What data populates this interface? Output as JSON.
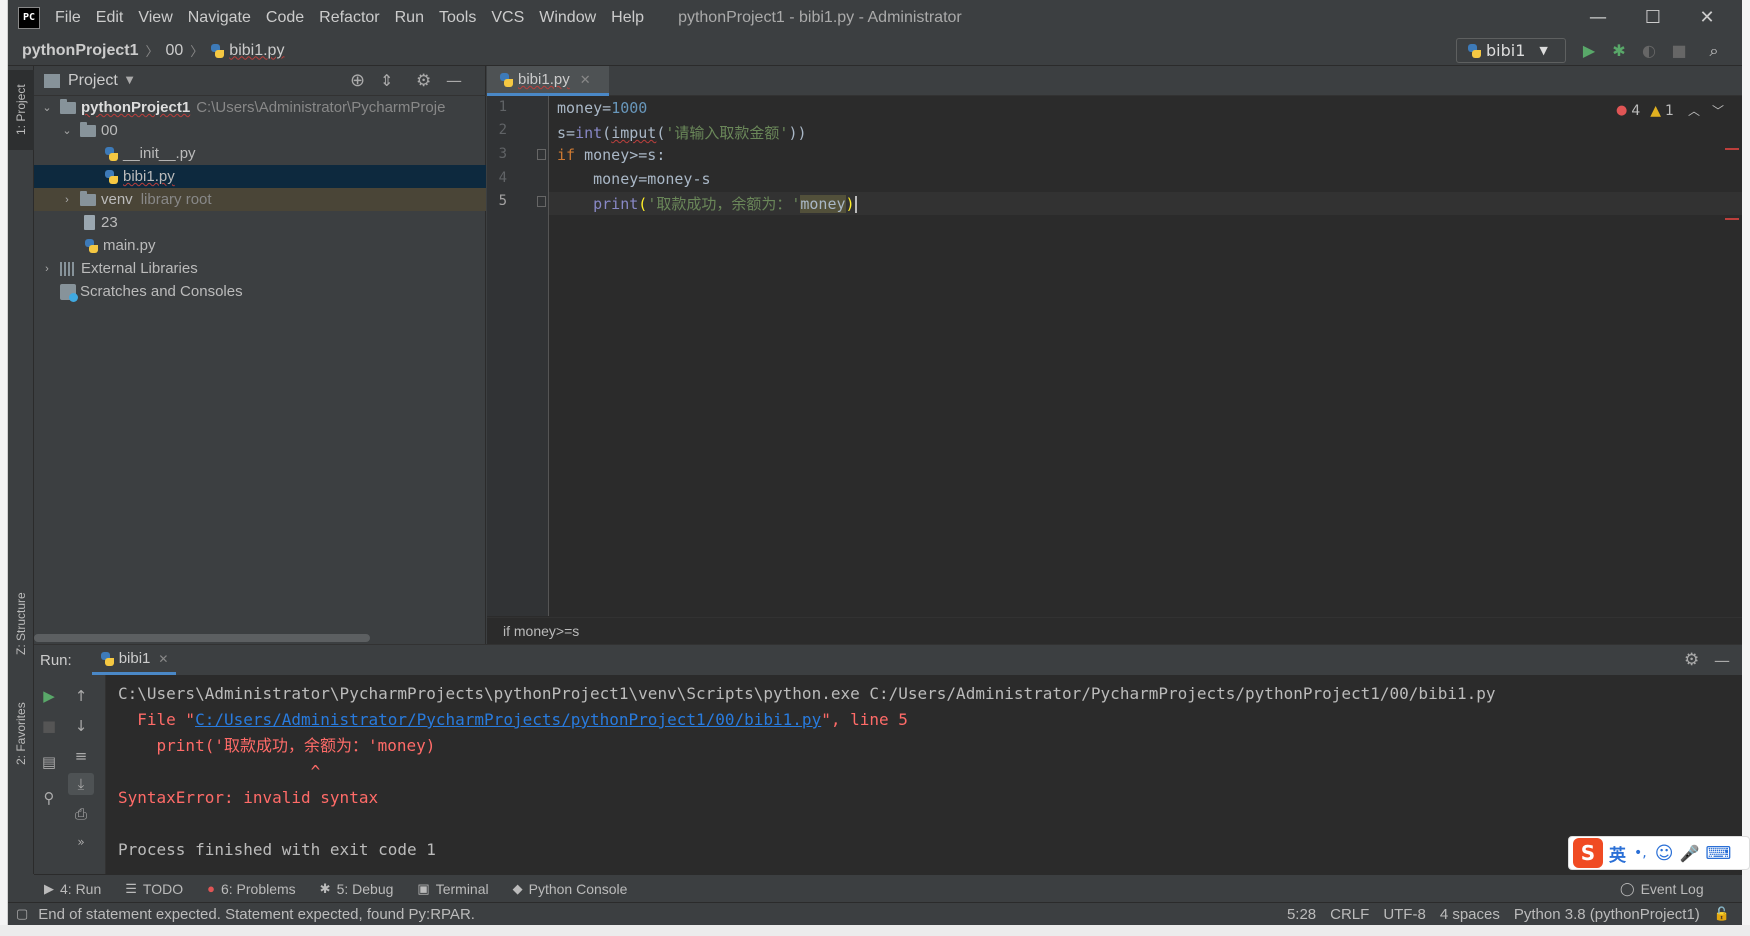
{
  "app": {
    "logo_text": "PC",
    "window_title": "pythonProject1 - bibi1.py - Administrator"
  },
  "menu": {
    "items": [
      "File",
      "Edit",
      "View",
      "Navigate",
      "Code",
      "Refactor",
      "Run",
      "Tools",
      "VCS",
      "Window",
      "Help"
    ]
  },
  "window_controls": {
    "minimize": "—",
    "maximize": "☐",
    "close": "✕"
  },
  "navbar": {
    "crumbs": [
      "pythonProject1",
      "00",
      "bibi1.py"
    ],
    "run_config": "bibi1"
  },
  "left_stripe": {
    "project_tab": "1: Project",
    "structure_tab": "Z: Structure",
    "favorites_tab": "2: Favorites"
  },
  "project_panel": {
    "title": "Project",
    "tree": [
      {
        "label": "pythonProject1",
        "hint": "C:\\Users\\Administrator\\PycharmProje",
        "type": "folder",
        "expanded": true
      },
      {
        "label": "00",
        "hint": "",
        "type": "folder",
        "expanded": true
      },
      {
        "label": "__init__.py",
        "hint": "",
        "type": "py"
      },
      {
        "label": "bibi1.py",
        "hint": "",
        "type": "py",
        "selected": true
      },
      {
        "label": "venv",
        "hint": "library root",
        "type": "folder",
        "expanded": false
      },
      {
        "label": "23",
        "hint": "",
        "type": "file"
      },
      {
        "label": "main.py",
        "hint": "",
        "type": "py"
      },
      {
        "label": "External Libraries",
        "hint": "",
        "type": "lib",
        "expanded": false
      },
      {
        "label": "Scratches and Consoles",
        "hint": "",
        "type": "scratch"
      }
    ]
  },
  "editor": {
    "tab_label": "bibi1.py",
    "line_numbers": [
      "1",
      "2",
      "3",
      "4",
      "5"
    ],
    "inspection": {
      "errors": "4",
      "warnings": "1"
    },
    "breadcrumb": "if money>=s"
  },
  "code": {
    "l1_var": "money",
    "l1_op": "=",
    "l1_num": "1000",
    "l2_a": "s=",
    "l2_int": "int",
    "l2_b": "(",
    "l2_imput": "imput",
    "l2_c": "(",
    "l2_str": "'请输入取款金额'",
    "l2_d": "))",
    "l3_if": "if",
    "l3_rest": " money>=s:",
    "l4": "    money=money-s",
    "l5_indent": "    ",
    "l5_print": "print",
    "l5_paren": "(",
    "l5_str": "'取款成功，余额为：'",
    "l5_var": "money",
    "l5_close": ")"
  },
  "run_panel": {
    "label": "Run:",
    "tab": "bibi1",
    "console": {
      "line1": "C:\\Users\\Administrator\\PycharmProjects\\pythonProject1\\venv\\Scripts\\python.exe C:/Users/Administrator/PycharmProjects/pythonProject1/00/bibi1.py",
      "line2_a": "  File \"",
      "line2_link": "C:/Users/Administrator/PycharmProjects/pythonProject1/00/bibi1.py",
      "line2_b": "\", line 5",
      "line3": "    print('取款成功，余额为：'money)",
      "line4": "                    ^",
      "line5": "SyntaxError: invalid syntax",
      "line6": "",
      "line7": "Process finished with exit code 1"
    }
  },
  "bottom_tools": [
    {
      "label": "4: Run",
      "icon": "▶"
    },
    {
      "label": "TODO",
      "icon": "☰"
    },
    {
      "label": "6: Problems",
      "icon": "●"
    },
    {
      "label": "5: Debug",
      "icon": "✱"
    },
    {
      "label": "Terminal",
      "icon": "▣"
    },
    {
      "label": "Python Console",
      "icon": "◆"
    }
  ],
  "event_log": "Event Log",
  "status": {
    "message": "End of statement expected. Statement expected, found Py:RPAR.",
    "position": "5:28",
    "line_sep": "CRLF",
    "encoding": "UTF-8",
    "indent": "4 spaces",
    "interpreter": "Python 3.8 (pythonProject1)"
  },
  "ime": {
    "logo": "S",
    "mode": "英",
    "punct": "•,",
    "emoji": "☺",
    "mic": "🎤",
    "kbd": "⌨"
  },
  "colors": {
    "bg": "#2b2b2b",
    "panel": "#3c3f41",
    "accent": "#4a88c7",
    "error": "#ff6b68",
    "link": "#287bde"
  }
}
